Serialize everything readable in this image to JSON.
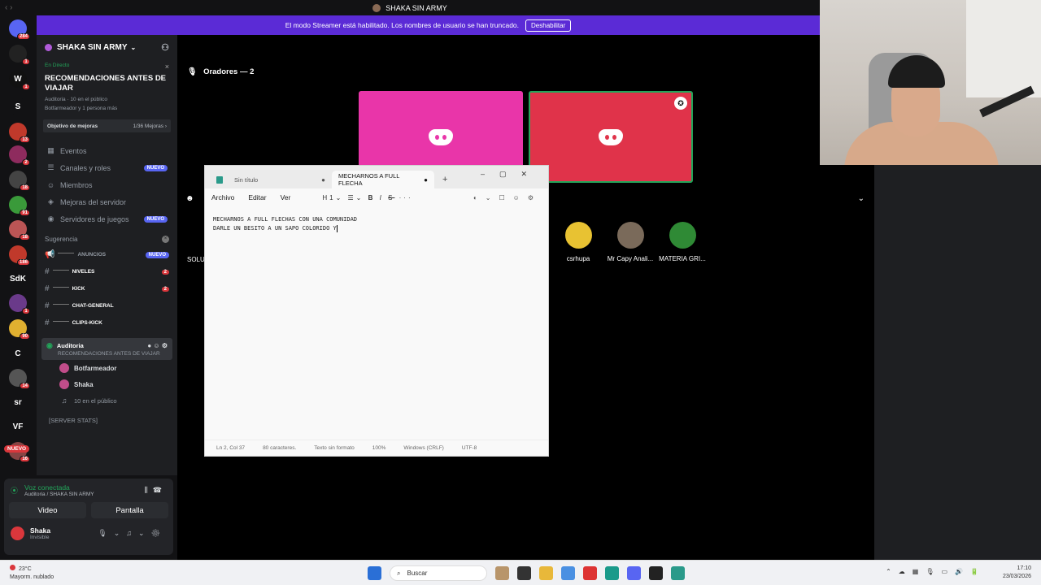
{
  "window": {
    "title": "SHAKA SIN ARMY"
  },
  "banner": {
    "text": "El modo Streamer está habilitado. Los nombres de usuario se han truncado.",
    "button": "Deshabilitar"
  },
  "rail": {
    "servers": [
      {
        "label": "",
        "badge": "284",
        "color": "#5865f2"
      },
      {
        "label": "",
        "badge": "1",
        "color": "#222"
      },
      {
        "label": "W",
        "badge": "1",
        "color": "#111"
      },
      {
        "label": "S",
        "badge": "",
        "color": "#121214"
      },
      {
        "label": "",
        "badge": "13",
        "color": "#c0392b"
      },
      {
        "label": "",
        "badge": "2",
        "color": "#8e2b5e"
      },
      {
        "label": "",
        "badge": "18",
        "color": "#444"
      },
      {
        "label": "",
        "badge": "91",
        "color": "#3a9a3a"
      },
      {
        "label": "",
        "badge": "18",
        "color": "#b55"
      },
      {
        "label": "",
        "badge": "186",
        "color": "#c0392b"
      },
      {
        "label": "SdK",
        "badge": "",
        "color": "#121214"
      },
      {
        "label": "",
        "badge": "1",
        "color": "#6a3a8a"
      },
      {
        "label": "",
        "badge": "90",
        "color": "#e0b030"
      },
      {
        "label": "C",
        "badge": "",
        "color": "#121214"
      },
      {
        "label": "",
        "badge": "14",
        "color": "#555"
      },
      {
        "label": "sr",
        "badge": "",
        "color": "#121214"
      },
      {
        "label": "VF",
        "badge": "",
        "color": "#121214"
      },
      {
        "label": "",
        "badge": "16",
        "color": "#884444"
      }
    ],
    "new_label": "NUEVO"
  },
  "sidebar": {
    "server_name": "SHAKA SIN ARMY",
    "stage": {
      "live": "En Directo",
      "title": "RECOMENDACIONES ANTES DE VIAJAR",
      "meta1": "Auditoria · 10 en el público",
      "meta2": "Botfarmeador y 1 persona más"
    },
    "goal": {
      "label": "Objetivo de mejoras",
      "value": "1/36 Mejoras ›"
    },
    "menu": [
      {
        "icon": "▦",
        "label": "Eventos",
        "badge": ""
      },
      {
        "icon": "☰",
        "label": "Canales y roles",
        "badge": "NUEVO"
      },
      {
        "icon": "☺",
        "label": "Miembros",
        "badge": ""
      },
      {
        "icon": "◈",
        "label": "Mejoras del servidor",
        "badge": ""
      },
      {
        "icon": "◉",
        "label": "Servidores de juegos",
        "badge": "NUEVO"
      }
    ],
    "section": "Sugerencia",
    "channels": [
      {
        "name": "ANUNCIOS",
        "count": "",
        "tag": "NUEVO"
      },
      {
        "name": "NIVELES",
        "count": "2",
        "tag": ""
      },
      {
        "name": "KICK",
        "count": "2",
        "tag": ""
      },
      {
        "name": "CHAT-GENERAL",
        "count": "",
        "tag": ""
      },
      {
        "name": "CLIPS-KICK",
        "count": "",
        "tag": ""
      }
    ],
    "voice_channel": {
      "name": "Auditoria",
      "sub": "RECOMENDACIONES ANTES DE VIAJAR"
    },
    "voice_users": [
      "Botfarmeador",
      "Shaka"
    ],
    "audience": "10 en el público",
    "server_stats": "[SERVER STATS]"
  },
  "voice_panel": {
    "status": "Voz conectada",
    "location": "Auditoria / SHAKA SIN ARMY",
    "video_button": "Video",
    "screen_button": "Pantalla",
    "user_name": "Shaka",
    "user_status": "Invisible"
  },
  "stage": {
    "speakers_label": "Oradores — 2",
    "audience_members": [
      "csrhupa",
      "Mr Capy Anali...",
      "MATERIA GRI..."
    ],
    "partial_member": "SOLU"
  },
  "notepad": {
    "tab1": "Sin título",
    "tab2": "MECHARNOS A FULL FLECHA",
    "menu": [
      "Archivo",
      "Editar",
      "Ver"
    ],
    "heading": "H1",
    "lines": [
      "MECHARNOS A FULL FLECHAS CON UNA COMUNIDAD",
      "DARLE UN BESITO A UN SAPO COLORIDO Y"
    ],
    "status": [
      "Ln 2, Col 37",
      "80 caracteres.",
      "Texto sin formato",
      "100%",
      "Windows (CRLF)",
      "UTF-8"
    ]
  },
  "taskbar": {
    "temp": "23°C",
    "weather": "Mayorm. nublado",
    "search": "Buscar",
    "time": "17:10",
    "date": "23/03/2026"
  }
}
